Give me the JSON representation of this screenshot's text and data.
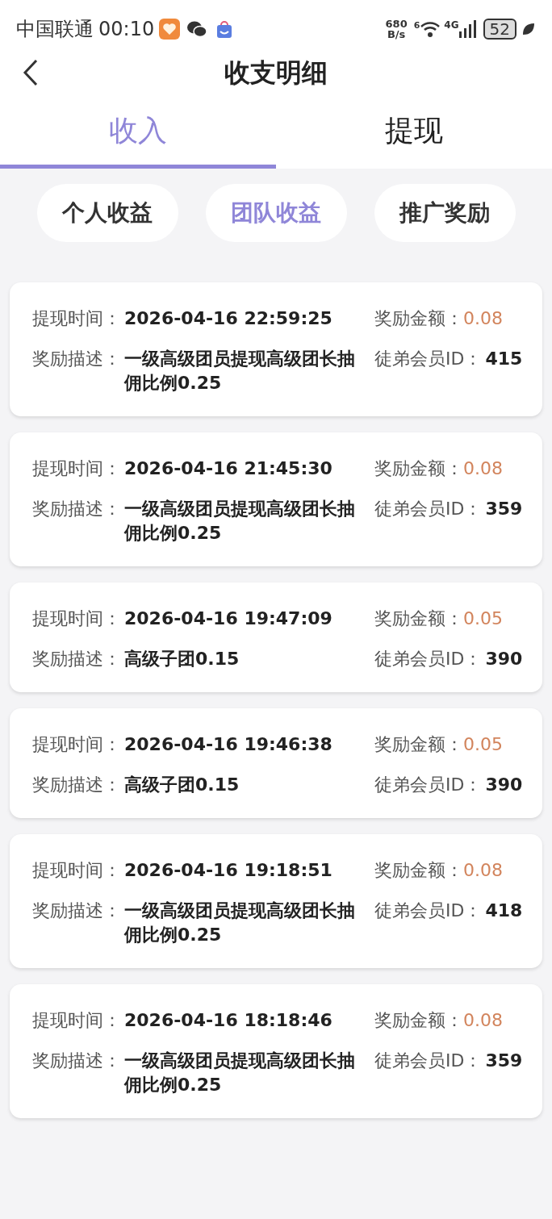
{
  "status_bar": {
    "carrier": "中国联通",
    "time": "00:10",
    "speed_value": "680",
    "speed_unit": "B/s",
    "wifi_badge": "6",
    "network": "4G",
    "battery": "52"
  },
  "header": {
    "title": "收支明细"
  },
  "tabs": [
    {
      "label": "收入",
      "selected": true
    },
    {
      "label": "提现",
      "selected": false
    }
  ],
  "filters": [
    {
      "label": "个人收益",
      "selected": false
    },
    {
      "label": "团队收益",
      "selected": true
    },
    {
      "label": "推广奖励",
      "selected": false
    }
  ],
  "records": [
    {
      "time_label": "提现时间：",
      "time": "2026-04-16 22:59:25",
      "amount_label": "奖励金额：",
      "amount": "0.08",
      "desc_label": "奖励描述：",
      "desc": "一级高级团员提现高级团长抽佣比例0.25",
      "member_label": "徒弟会员ID：",
      "member_id": "415"
    },
    {
      "time_label": "提现时间：",
      "time": "2026-04-16 21:45:30",
      "amount_label": "奖励金额：",
      "amount": "0.08",
      "desc_label": "奖励描述：",
      "desc": "一级高级团员提现高级团长抽佣比例0.25",
      "member_label": "徒弟会员ID：",
      "member_id": "359"
    },
    {
      "time_label": "提现时间：",
      "time": "2026-04-16 19:47:09",
      "amount_label": "奖励金额：",
      "amount": "0.05",
      "desc_label": "奖励描述：",
      "desc": "高级子团0.15",
      "member_label": "徒弟会员ID：",
      "member_id": "390"
    },
    {
      "time_label": "提现时间：",
      "time": "2026-04-16 19:46:38",
      "amount_label": "奖励金额：",
      "amount": "0.05",
      "desc_label": "奖励描述：",
      "desc": "高级子团0.15",
      "member_label": "徒弟会员ID：",
      "member_id": "390"
    },
    {
      "time_label": "提现时间：",
      "time": "2026-04-16 19:18:51",
      "amount_label": "奖励金额：",
      "amount": "0.08",
      "desc_label": "奖励描述：",
      "desc": "一级高级团员提现高级团长抽佣比例0.25",
      "member_label": "徒弟会员ID：",
      "member_id": "418"
    },
    {
      "time_label": "提现时间：",
      "time": "2026-04-16 18:18:46",
      "amount_label": "奖励金额：",
      "amount": "0.08",
      "desc_label": "奖励描述：",
      "desc": "一级高级团员提现高级团长抽佣比例0.25",
      "member_label": "徒弟会员ID：",
      "member_id": "359"
    }
  ]
}
